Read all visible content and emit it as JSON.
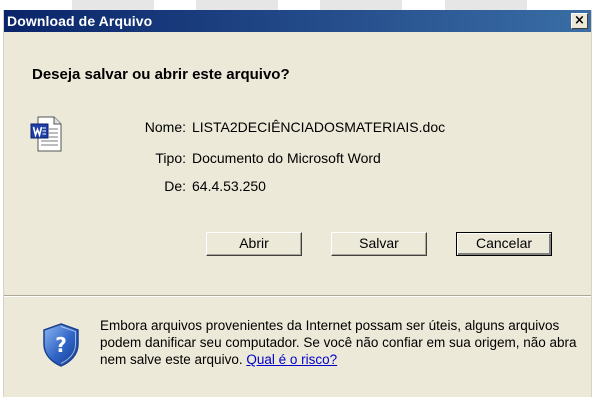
{
  "dialog": {
    "title": "Download de Arquivo",
    "close_glyph": "×",
    "question": "Deseja salvar ou abrir este arquivo?",
    "file_icon": "word-document-icon",
    "info": [
      {
        "label": "Nome:",
        "value": "LISTA2DECIÊNCIADOSMATERIAIS.doc"
      },
      {
        "label": "Tipo:",
        "value": "Documento do Microsoft Word"
      },
      {
        "label": "De:",
        "value": "64.4.53.250"
      }
    ],
    "buttons": {
      "open": "Abrir",
      "save": "Salvar",
      "cancel": "Cancelar"
    },
    "warning_icon": "shield-question-icon",
    "warning_text": "Embora arquivos provenientes da Internet possam ser úteis, alguns arquivos podem danificar seu computador. Se você não confiar em sua origem, não abra nem salve este arquivo.",
    "risk_link": "Qual é o risco?"
  },
  "colors": {
    "titlebar_start": "#0a246a",
    "titlebar_end": "#3a6ea5",
    "dialog_bg": "#ece9d8",
    "link": "#0000cc"
  }
}
